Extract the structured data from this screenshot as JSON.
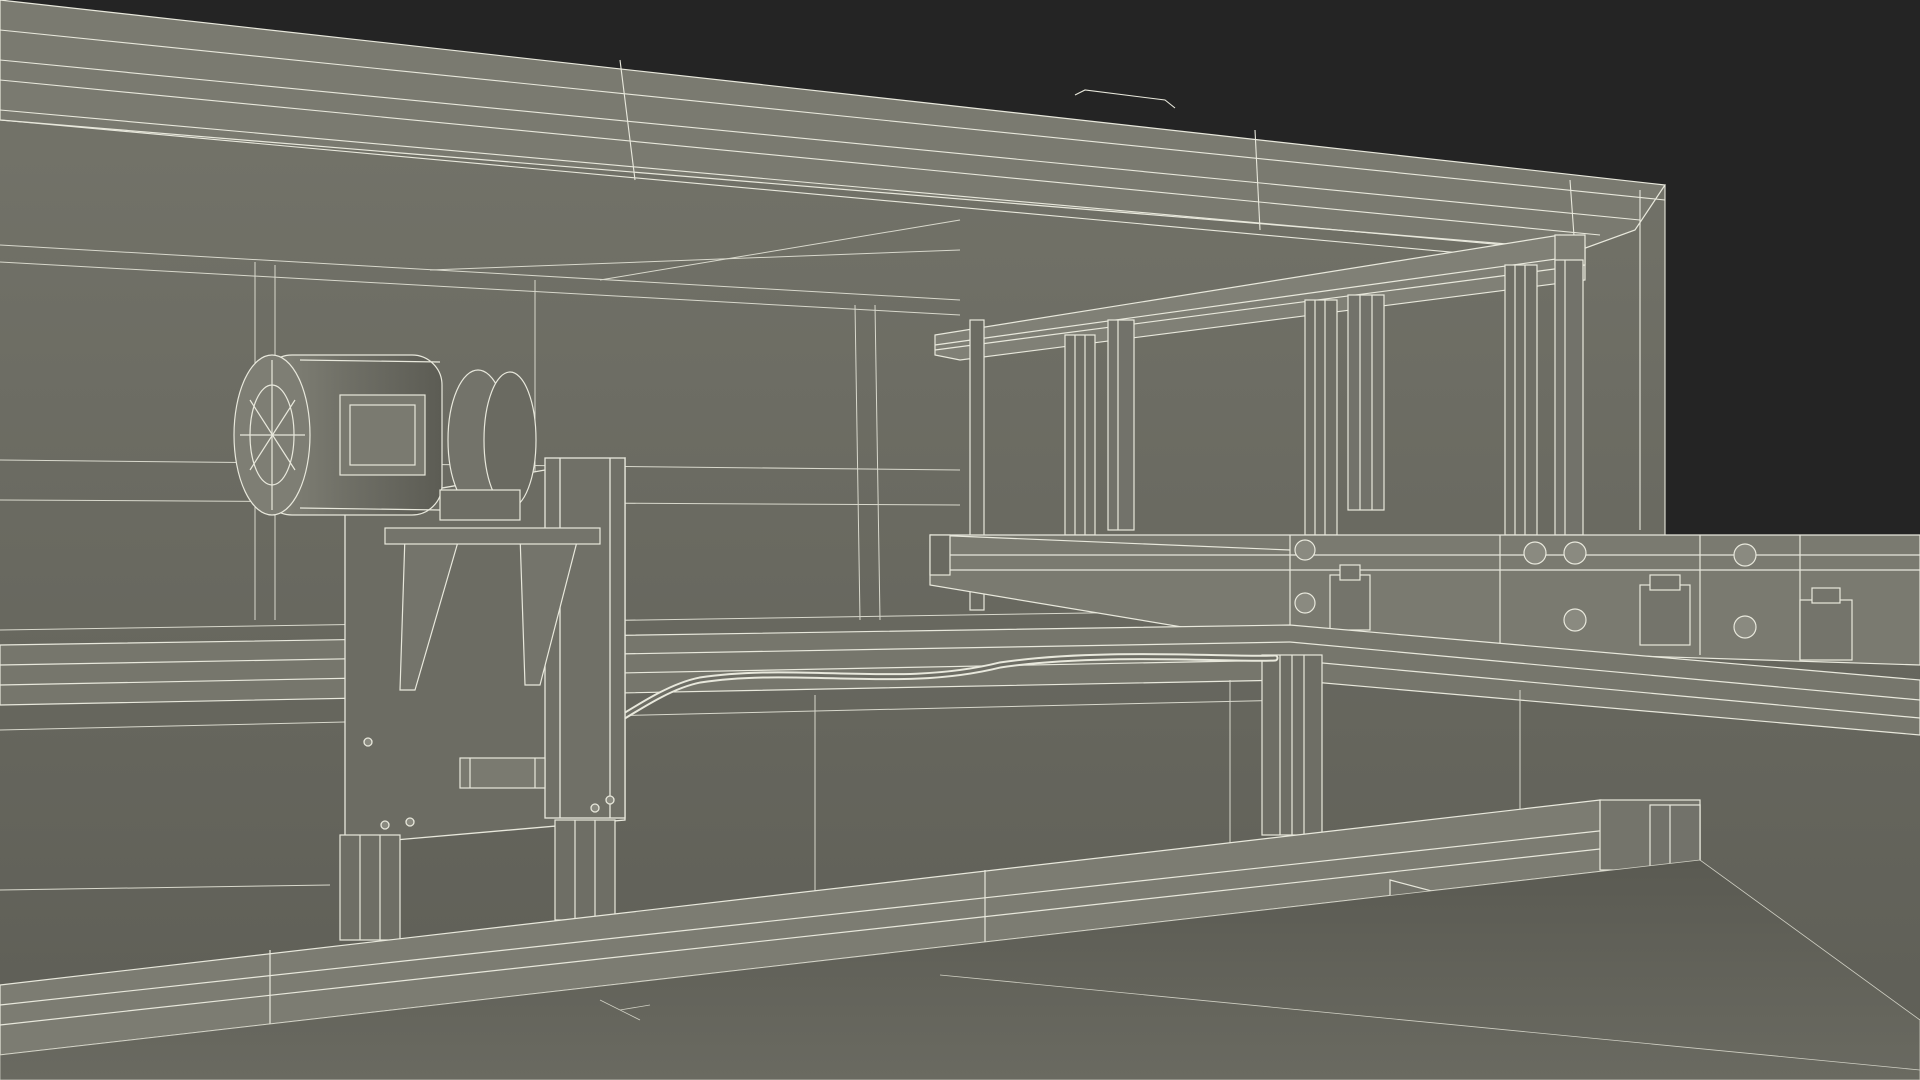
{
  "colors": {
    "background": "#242424",
    "surface": "#6b6b62",
    "surface_light": "#7c7c72",
    "surface_dark": "#55554d",
    "wire": "#e8e8dc",
    "wire_dim": "#b9b9ad",
    "shadow": "#44443e"
  },
  "objects": [
    "room-enclosure",
    "ceiling-frame",
    "electric-motor",
    "motor-mount-plate",
    "cable",
    "cable-junction-box",
    "conveyor-rail",
    "bolted-bracket-plate",
    "rail-clamp",
    "base-frame-rail"
  ]
}
